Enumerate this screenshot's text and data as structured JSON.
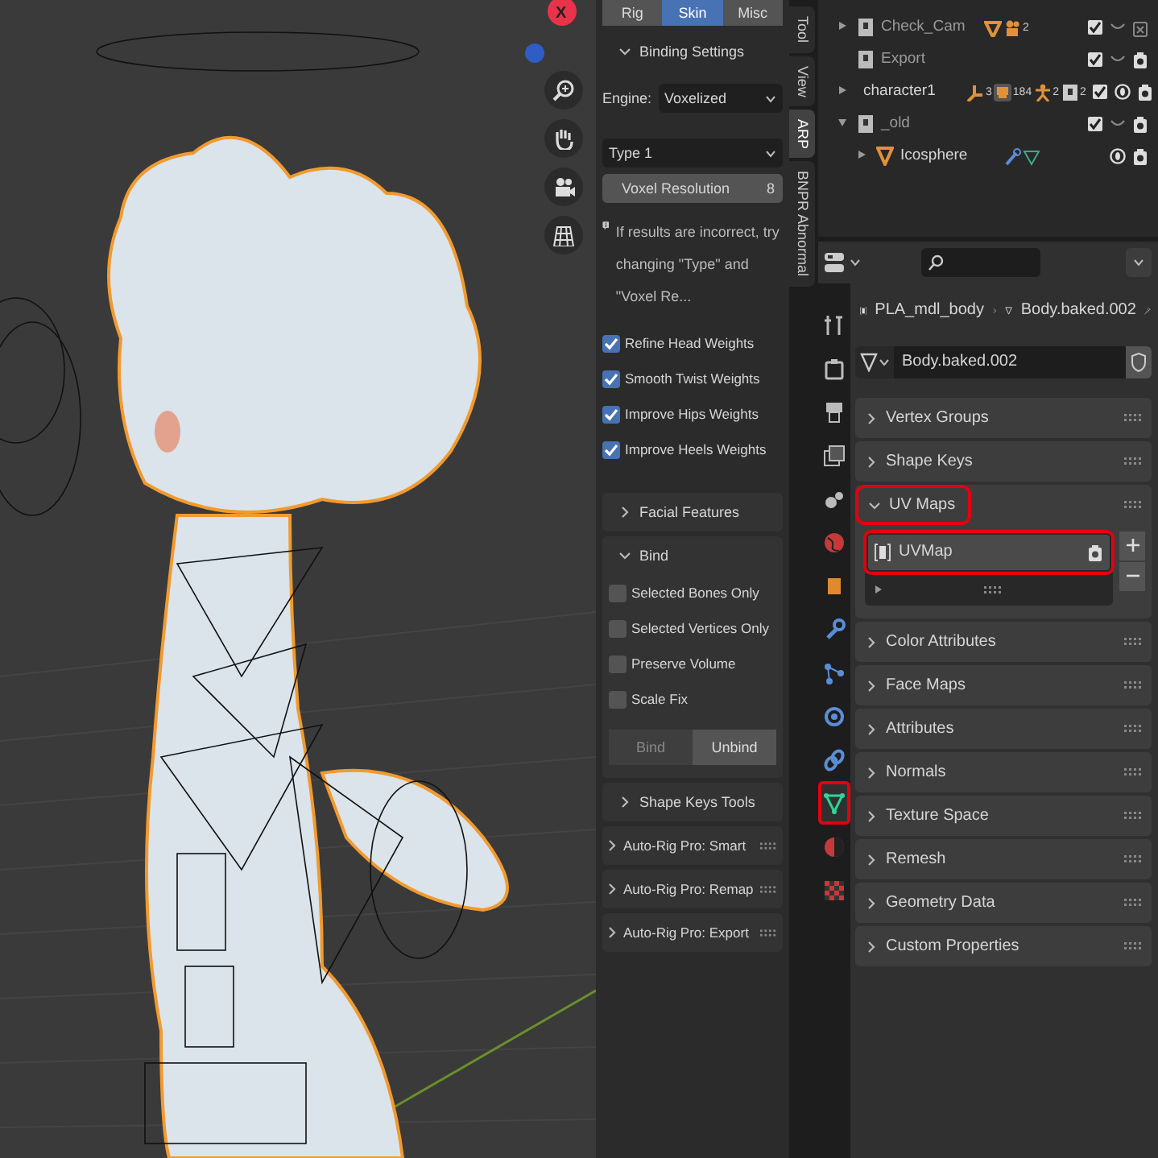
{
  "viewport": {
    "gizmo_label": "X"
  },
  "sidebar": {
    "tabs": [
      {
        "label": "Rig",
        "selected": false
      },
      {
        "label": "Skin",
        "selected": true
      },
      {
        "label": "Misc",
        "selected": false
      }
    ],
    "binding_settings": {
      "title": "Binding Settings",
      "expanded": true
    },
    "engine": {
      "label": "Engine:",
      "value": "Voxelized"
    },
    "type_dropdown": {
      "value": "Type 1"
    },
    "voxel_resolution": {
      "label": "Voxel Resolution",
      "value": "8"
    },
    "info": "If results are incorrect, try changing \"Type\" and \"Voxel Re...",
    "options": [
      {
        "label": "Refine Head Weights",
        "checked": true
      },
      {
        "label": "Smooth Twist Weights",
        "checked": true
      },
      {
        "label": "Improve Hips Weights",
        "checked": true
      },
      {
        "label": "Improve Heels Weights",
        "checked": true
      }
    ],
    "facial_features": {
      "title": "Facial Features",
      "expanded": false
    },
    "bind": {
      "title": "Bind",
      "expanded": true,
      "options": [
        {
          "label": "Selected Bones Only",
          "checked": false
        },
        {
          "label": "Selected Vertices Only",
          "checked": false
        },
        {
          "label": "Preserve Volume",
          "checked": false
        },
        {
          "label": "Scale Fix",
          "checked": false
        }
      ],
      "buttons": [
        {
          "label": "Bind",
          "disabled": true
        },
        {
          "label": "Unbind",
          "disabled": false
        }
      ]
    },
    "shape_keys_tools": {
      "title": "Shape Keys Tools",
      "expanded": false
    },
    "panels": [
      {
        "title": "Auto-Rig Pro: Smart",
        "expanded": false
      },
      {
        "title": "Auto-Rig Pro: Remap",
        "expanded": false
      },
      {
        "title": "Auto-Rig Pro: Export",
        "expanded": false
      }
    ]
  },
  "vertical_tabs": [
    {
      "label": "Tool",
      "selected": false
    },
    {
      "label": "View",
      "selected": false
    },
    {
      "label": "ARP",
      "selected": true
    },
    {
      "label": "BNPR Abnormal",
      "selected": false
    }
  ],
  "outliner": {
    "items": [
      {
        "name": "Check_Cam",
        "kind": "collection",
        "expanded": false,
        "badges": [
          {
            "kind": "mesh"
          },
          {
            "kind": "camera",
            "count": "2"
          }
        ],
        "checked": true,
        "visible": false,
        "renderable": false
      },
      {
        "name": "Export",
        "kind": "collection",
        "checked": true,
        "visible": false,
        "renderable": true
      },
      {
        "name": "character1",
        "kind": "collection",
        "expanded": false,
        "badges": [
          {
            "kind": "armature",
            "count": "3"
          },
          {
            "kind": "objects",
            "count": "184"
          },
          {
            "kind": "pose",
            "count": "2"
          },
          {
            "kind": "collection",
            "count": "2"
          }
        ],
        "checked": true,
        "visible": true,
        "renderable": true
      },
      {
        "name": "_old",
        "kind": "collection",
        "expanded": true,
        "checked": true,
        "visible": false,
        "renderable": true,
        "children": [
          {
            "name": "Icosphere",
            "kind": "object",
            "expanded": false,
            "badges": [
              {
                "kind": "modifier"
              },
              {
                "kind": "mesh_data"
              }
            ],
            "visible": true,
            "renderable": true
          }
        ]
      }
    ]
  },
  "properties": {
    "tabs": [
      {
        "kind": "tool",
        "selected": false,
        "highlighted": false
      },
      {
        "kind": "render",
        "selected": false,
        "highlighted": false
      },
      {
        "kind": "output",
        "selected": false,
        "highlighted": false
      },
      {
        "kind": "view_layer",
        "selected": false,
        "highlighted": false
      },
      {
        "kind": "scene",
        "selected": false,
        "highlighted": false
      },
      {
        "kind": "world",
        "selected": false,
        "highlighted": false
      },
      {
        "kind": "object",
        "selected": false,
        "highlighted": false
      },
      {
        "kind": "modifier",
        "selected": false,
        "highlighted": false
      },
      {
        "kind": "particles",
        "selected": false,
        "highlighted": false
      },
      {
        "kind": "physics",
        "selected": false,
        "highlighted": false
      },
      {
        "kind": "constraints",
        "selected": false,
        "highlighted": false
      },
      {
        "kind": "data",
        "selected": true,
        "highlighted": true
      },
      {
        "kind": "material",
        "selected": false,
        "highlighted": false
      },
      {
        "kind": "texture",
        "selected": false,
        "highlighted": false
      }
    ],
    "breadcrumb": [
      "PLA_mdl_body",
      "Body.baked.002"
    ],
    "datablock": "Body.baked.002",
    "panels": [
      {
        "title": "Vertex Groups",
        "expanded": false,
        "highlighted": false
      },
      {
        "title": "Shape Keys",
        "expanded": false,
        "highlighted": false
      },
      {
        "title": "UV Maps",
        "expanded": true,
        "highlighted": true,
        "uv_maps": [
          {
            "name": "UVMap",
            "selected": true,
            "highlighted": true
          }
        ]
      },
      {
        "title": "Color Attributes",
        "expanded": false,
        "highlighted": false
      },
      {
        "title": "Face Maps",
        "expanded": false,
        "highlighted": false
      },
      {
        "title": "Attributes",
        "expanded": false,
        "highlighted": false
      },
      {
        "title": "Normals",
        "expanded": false,
        "highlighted": false
      },
      {
        "title": "Texture Space",
        "expanded": false,
        "highlighted": false
      },
      {
        "title": "Remesh",
        "expanded": false,
        "highlighted": false
      },
      {
        "title": "Geometry Data",
        "expanded": false,
        "highlighted": false
      },
      {
        "title": "Custom Properties",
        "expanded": false,
        "highlighted": false
      }
    ]
  }
}
